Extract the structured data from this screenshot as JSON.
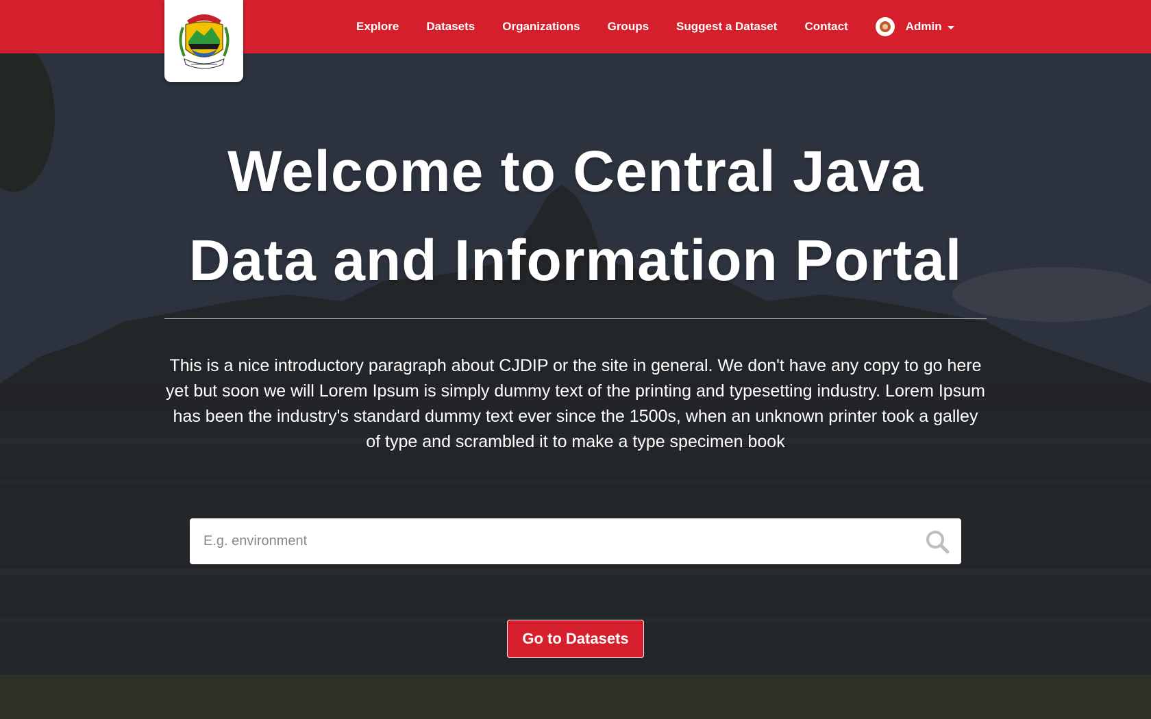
{
  "nav": {
    "logo_alt": "Central Java provincial emblem",
    "links": [
      {
        "label": "Explore"
      },
      {
        "label": "Datasets"
      },
      {
        "label": "Organizations"
      },
      {
        "label": "Groups"
      },
      {
        "label": "Suggest a Dataset"
      },
      {
        "label": "Contact"
      }
    ],
    "user": {
      "label": "Admin",
      "icon": "user-avatar-icon"
    }
  },
  "hero": {
    "title_line1": "Welcome to Central Java",
    "title_line2": "Data and Information Portal",
    "intro": "This is a nice introductory paragraph about CJDIP or the site in general. We don't have any copy to go here yet but soon we will Lorem Ipsum is simply dummy text of the printing and typesetting industry. Lorem Ipsum has been the industry's standard dummy text ever since the 1500s, when an unknown printer took a galley of type and scrambled it to make a type specimen book",
    "search": {
      "placeholder": "E.g. environment",
      "value": "",
      "icon": "search-icon"
    },
    "cta_label": "Go to Datasets"
  },
  "colors": {
    "brand_red": "#d61f2c",
    "text_white": "#ffffff"
  }
}
